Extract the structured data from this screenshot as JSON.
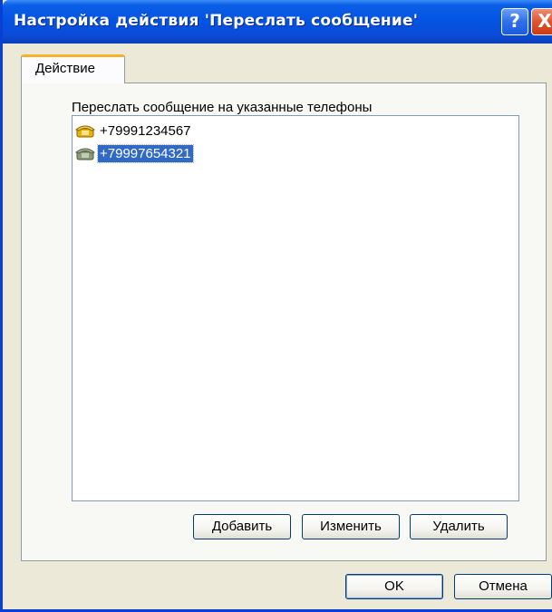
{
  "window": {
    "title": "Настройка действия 'Переслать сообщение'",
    "help_glyph": "?",
    "close_glyph": "X"
  },
  "tabs": [
    {
      "label": "Действие"
    }
  ],
  "action": {
    "list_label": "Переслать сообщение на указанные телефоны",
    "phones": [
      {
        "number": "+79991234567",
        "icon": "phone-yellow-icon",
        "selected": false
      },
      {
        "number": "+79997654321",
        "icon": "phone-gray-icon",
        "selected": true
      }
    ],
    "buttons": {
      "add": "Добавить",
      "edit": "Изменить",
      "delete": "Удалить"
    }
  },
  "footer": {
    "ok": "OK",
    "cancel": "Отмена"
  },
  "colors": {
    "titlebar": "#0454e3",
    "selection": "#316ac5",
    "tab_highlight": "#f6b130",
    "dialog_bg": "#ece9d8"
  }
}
